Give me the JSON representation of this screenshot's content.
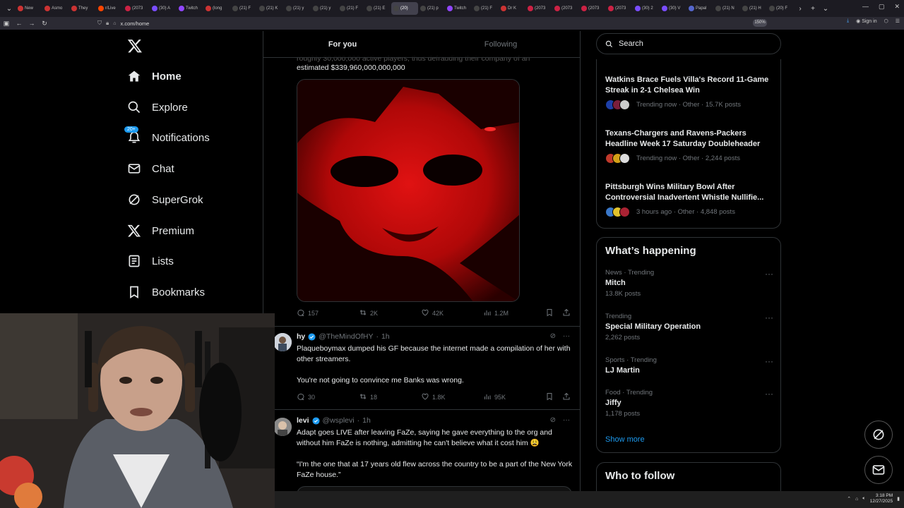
{
  "browser": {
    "tabs": [
      {
        "label": "New",
        "color": "#cc3333"
      },
      {
        "label": "Asmo",
        "color": "#cc3333"
      },
      {
        "label": "They",
        "color": "#cc3333"
      },
      {
        "label": "r/Live",
        "color": "#ff4500"
      },
      {
        "label": "(2073",
        "color": "#cc2244"
      },
      {
        "label": "(30) A",
        "color": "#7a4dff"
      },
      {
        "label": "Twitch",
        "color": "#9146ff"
      },
      {
        "label": "(long",
        "color": "#cc3333"
      },
      {
        "label": "(21) F",
        "color": "#444"
      },
      {
        "label": "(21) K",
        "color": "#444"
      },
      {
        "label": "(21) y",
        "color": "#444"
      },
      {
        "label": "(21) y",
        "color": "#444"
      },
      {
        "label": "(21) F",
        "color": "#444"
      },
      {
        "label": "(21) E",
        "color": "#444"
      },
      {
        "label": "(20)",
        "color": "#444",
        "active": true
      },
      {
        "label": "(21) p",
        "color": "#444"
      },
      {
        "label": "Twitch",
        "color": "#9146ff"
      },
      {
        "label": "(21) F",
        "color": "#444"
      },
      {
        "label": "Dr K",
        "color": "#cc3333"
      },
      {
        "label": "(2073",
        "color": "#cc2244"
      },
      {
        "label": "(2073",
        "color": "#cc2244"
      },
      {
        "label": "(2073",
        "color": "#cc2244"
      },
      {
        "label": "(2073",
        "color": "#cc2244"
      },
      {
        "label": "(30) 2",
        "color": "#7a4dff"
      },
      {
        "label": "(30) V",
        "color": "#7a4dff"
      },
      {
        "label": "Papal",
        "color": "#5566cc"
      },
      {
        "label": "(21) N",
        "color": "#444"
      },
      {
        "label": "(21) H",
        "color": "#444"
      },
      {
        "label": "(20) F",
        "color": "#444"
      }
    ],
    "url": "x.com/home",
    "zoom": "150%",
    "sign_in": "Sign in"
  },
  "nav": {
    "items": [
      {
        "key": "home",
        "label": "Home",
        "icon": "home-icon",
        "active": true
      },
      {
        "key": "explore",
        "label": "Explore",
        "icon": "search-icon"
      },
      {
        "key": "notifications",
        "label": "Notifications",
        "icon": "bell-icon",
        "badge": "20+"
      },
      {
        "key": "chat",
        "label": "Chat",
        "icon": "mail-icon"
      },
      {
        "key": "supergrok",
        "label": "SuperGrok",
        "icon": "grok-icon"
      },
      {
        "key": "premium",
        "label": "Premium",
        "icon": "x-icon"
      },
      {
        "key": "lists",
        "label": "Lists",
        "icon": "list-icon"
      },
      {
        "key": "bookmarks",
        "label": "Bookmarks",
        "icon": "bookmark-icon"
      }
    ]
  },
  "feed": {
    "tabs": {
      "for_you": "For you",
      "following": "Following"
    },
    "tweet1": {
      "partial_text": "roughly 30,000,000 active players, thus defrauding their company of an",
      "text": "estimated $339,960,000,000,000",
      "replies": "157",
      "reposts": "2K",
      "likes": "42K",
      "views": "1.2M"
    },
    "tweet2": {
      "name": "hy",
      "handle": "@TheMindOfHY",
      "time": "1h",
      "text1": "Plaqueboymax dumped his GF because the internet made a compilation of her with other streamers.",
      "text2": "You're not going to convince me Banks was wrong.",
      "replies": "30",
      "reposts": "18",
      "likes": "1.8K",
      "views": "95K"
    },
    "tweet3": {
      "name": "levi",
      "handle": "@wsplevi",
      "time": "1h",
      "text1": "Adapt goes LIVE after leaving FaZe, saying he gave everything to the org and without him FaZe is nothing, admitting he can't believe what it cost him 😩",
      "text2": "“I'm the one that at 17 years old flew across the country to be a part of the New York FaZe house.”"
    }
  },
  "right": {
    "search_placeholder": "Search",
    "news": [
      {
        "title": "Watkins Brace Fuels Villa's Record 11-Game Streak in 2-1 Chelsea Win",
        "meta": "Trending now · Other · 15.7K posts",
        "colors": [
          "#1d3fa8",
          "#7a1e3b",
          "#cccccc"
        ]
      },
      {
        "title": "Texans-Chargers and Ravens-Packers Headline Week 17 Saturday Doubleheader",
        "meta": "Trending now · Other · 2,244 posts",
        "colors": [
          "#c0392b",
          "#d4a017",
          "#dddddd"
        ]
      },
      {
        "title": "Pittsburgh Wins Military Bowl After Controversial Inadvertent Whistle Nullifie...",
        "meta": "3 hours ago · Other · 4,848 posts",
        "colors": [
          "#3a78c9",
          "#e1c22d",
          "#aa2233"
        ]
      }
    ],
    "happening_title": "What’s happening",
    "trends": [
      {
        "category": "News · Trending",
        "name": "Mitch",
        "posts": "13.8K posts"
      },
      {
        "category": "Trending",
        "name": "Special Military Operation",
        "posts": "2,262 posts"
      },
      {
        "category": "Sports · Trending",
        "name": "LJ Martin",
        "posts": ""
      },
      {
        "category": "Food · Trending",
        "name": "Jiffy",
        "posts": "1,178 posts"
      }
    ],
    "show_more": "Show more",
    "who_to_follow": "Who to follow"
  },
  "taskbar": {
    "time": "3:18 PM",
    "date": "12/27/2025"
  },
  "colors": {
    "accent": "#1d9bf0",
    "bg": "#000000",
    "border": "#2f3336",
    "muted": "#71767b"
  }
}
